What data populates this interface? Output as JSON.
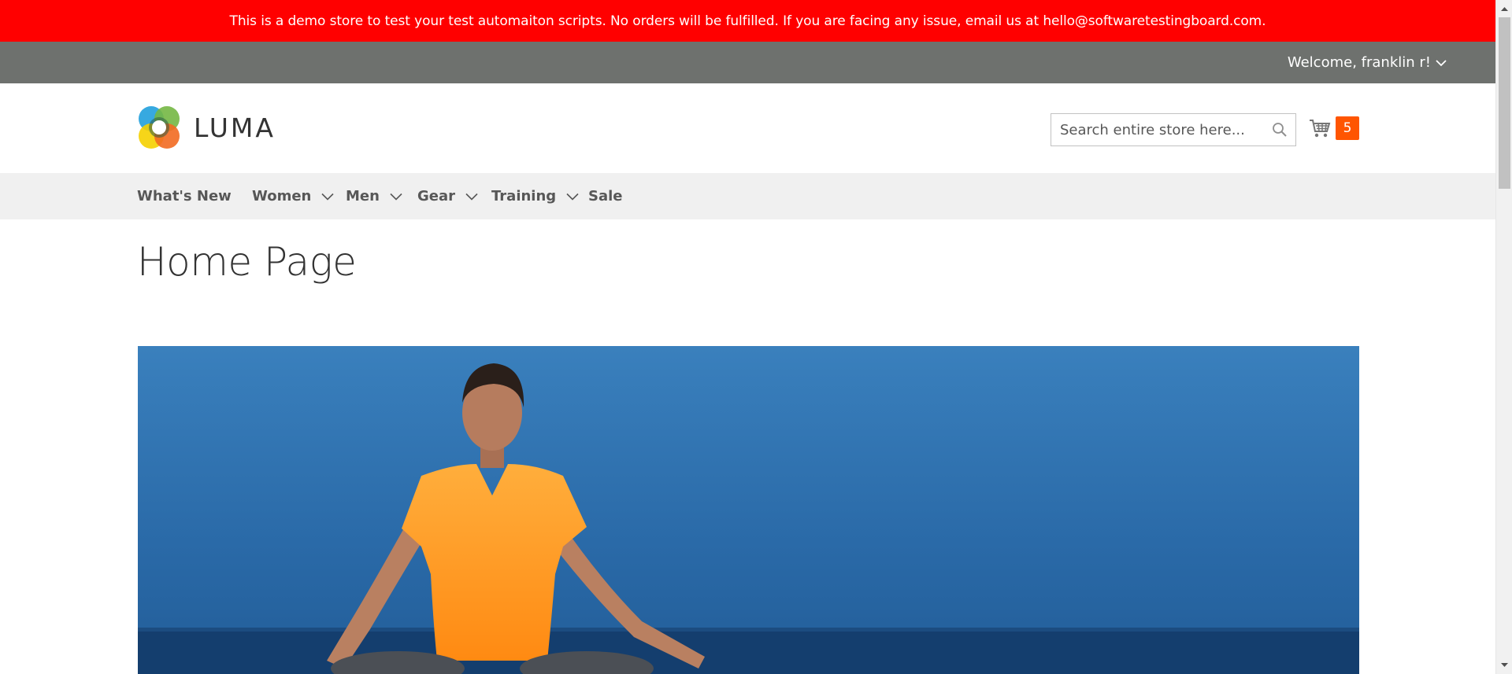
{
  "demo_notice": "This is a demo store to test your test automaiton scripts. No orders will be fulfilled. If you are facing any issue, email us at hello@softwaretestingboard.com.",
  "header_panel": {
    "welcome": "Welcome, franklin r!"
  },
  "logo": {
    "text": "LUMA"
  },
  "search": {
    "placeholder": "Search entire store here..."
  },
  "cart": {
    "count": "5"
  },
  "nav": {
    "items": [
      {
        "label": "What's New",
        "has_dropdown": false
      },
      {
        "label": "Women",
        "has_dropdown": true
      },
      {
        "label": "Men",
        "has_dropdown": true
      },
      {
        "label": "Gear",
        "has_dropdown": true
      },
      {
        "label": "Training",
        "has_dropdown": true
      },
      {
        "label": "Sale",
        "has_dropdown": false
      }
    ]
  },
  "page": {
    "title": "Home Page"
  },
  "colors": {
    "notice_bg": "#ff0000",
    "panel_bg": "#6e716e",
    "nav_bg": "#f0f0f0",
    "cart_badge": "#ff5501",
    "hero_sky": "#2b6eac",
    "shirt": "#ff9a1f"
  },
  "icons": [
    "chevron-down-icon",
    "search-icon",
    "cart-icon",
    "luma-logo-icon"
  ]
}
